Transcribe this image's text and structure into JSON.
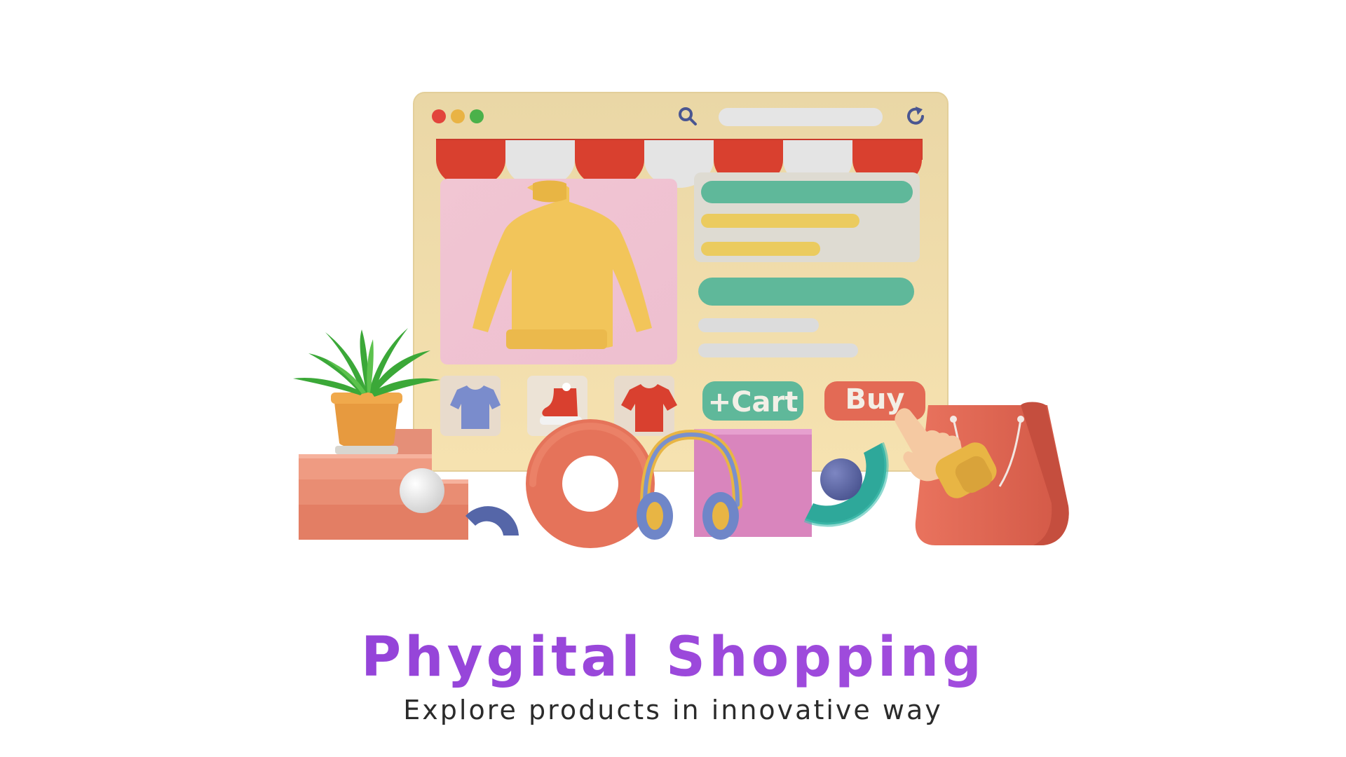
{
  "hero": {
    "title": "Phygital Shopping",
    "subtitle": "Explore products in innovative way"
  },
  "storefront": {
    "cart_label": "+Cart",
    "buy_label": "Buy"
  },
  "colors": {
    "title": "#9a48d8",
    "window": "#f1dfac",
    "awning_red": "#d9402f",
    "awning_white": "#e6e6e6",
    "accent_green": "#5fb89a",
    "accent_yellow": "#ebcb5f",
    "cart_button": "#5fb89a",
    "buy_button": "#e36a55"
  },
  "icons": [
    "search-icon",
    "refresh-icon",
    "sweater-icon",
    "tshirt-icon",
    "shoe-icon",
    "plant-icon",
    "headphones-icon",
    "shopping-bag-icon",
    "pointing-hand-icon"
  ]
}
